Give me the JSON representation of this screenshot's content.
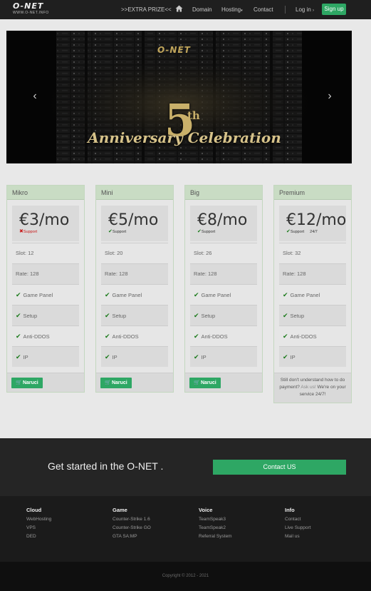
{
  "nav": {
    "logo_main": "O-NET",
    "logo_sub": "WWW.O-NET.INFO",
    "extra_prize": ">>EXTRA PRIZE<<",
    "domain": "Domain",
    "hosting": "Hosting",
    "contact": "Contact",
    "login": "Log in",
    "signup": "Sign up"
  },
  "banner": {
    "logo": "O-NET",
    "number": "5",
    "suffix": "th",
    "caption": "Anniversary Celebration"
  },
  "plans": [
    {
      "name": "Mikro",
      "price": "€3/mo",
      "support": "Support",
      "support_ok": false,
      "slot": "Slot: 12",
      "rate": "Rate: 128",
      "features": [
        "Game Panel",
        "Setup",
        "Anti-DDOS",
        "IP"
      ],
      "button": "Naruci"
    },
    {
      "name": "Mini",
      "price": "€5/mo",
      "support": "Support",
      "support_ok": true,
      "slot": "Slot: 20",
      "rate": "Rate: 128",
      "features": [
        "Game Panel",
        "Setup",
        "Anti-DDOS",
        "IP"
      ],
      "button": "Naruci"
    },
    {
      "name": "Big",
      "price": "€8/mo",
      "support": "Support",
      "support_ok": true,
      "slot": "Slot: 26",
      "rate": "Rate: 128",
      "features": [
        "Game Panel",
        "Setup",
        "Anti-DDOS",
        "IP"
      ],
      "button": "Naruci"
    },
    {
      "name": "Premium",
      "price": "€12/mo",
      "support": "Support",
      "support_extra": "24/7",
      "support_ok": true,
      "slot": "Slot: 32",
      "rate": "Rate: 128",
      "features": [
        "Game Panel",
        "Setup",
        "Anti-DDOS",
        "IP"
      ],
      "help_before": "Still don't understand how to do payment?",
      "help_link": "Ask us!",
      "help_after": "We're on your service 24/7!"
    }
  ],
  "cta": {
    "text": "Get started in the O-NET .",
    "button": "Contact US"
  },
  "footer": {
    "columns": [
      {
        "title": "Cloud",
        "links": [
          "WebHosting",
          "VPS",
          "DED"
        ]
      },
      {
        "title": "Game",
        "links": [
          "Counter-Strike 1.6",
          "Counter-Strike GO",
          "GTA SA:MP"
        ]
      },
      {
        "title": "Voice",
        "links": [
          "TeamSpeak3",
          "TeamSpeak2",
          "Referral System"
        ]
      },
      {
        "title": "Info",
        "links": [
          "Contact",
          "Live Support",
          "Mail us"
        ]
      }
    ],
    "copyright": "Copyright © 2012 - 2021"
  },
  "colors": {
    "accent": "#2ea764",
    "nav_bg": "#1f1f1f",
    "plan_header": "#c9dcc4",
    "check": "#1a7a1a",
    "cross": "#c81818"
  }
}
